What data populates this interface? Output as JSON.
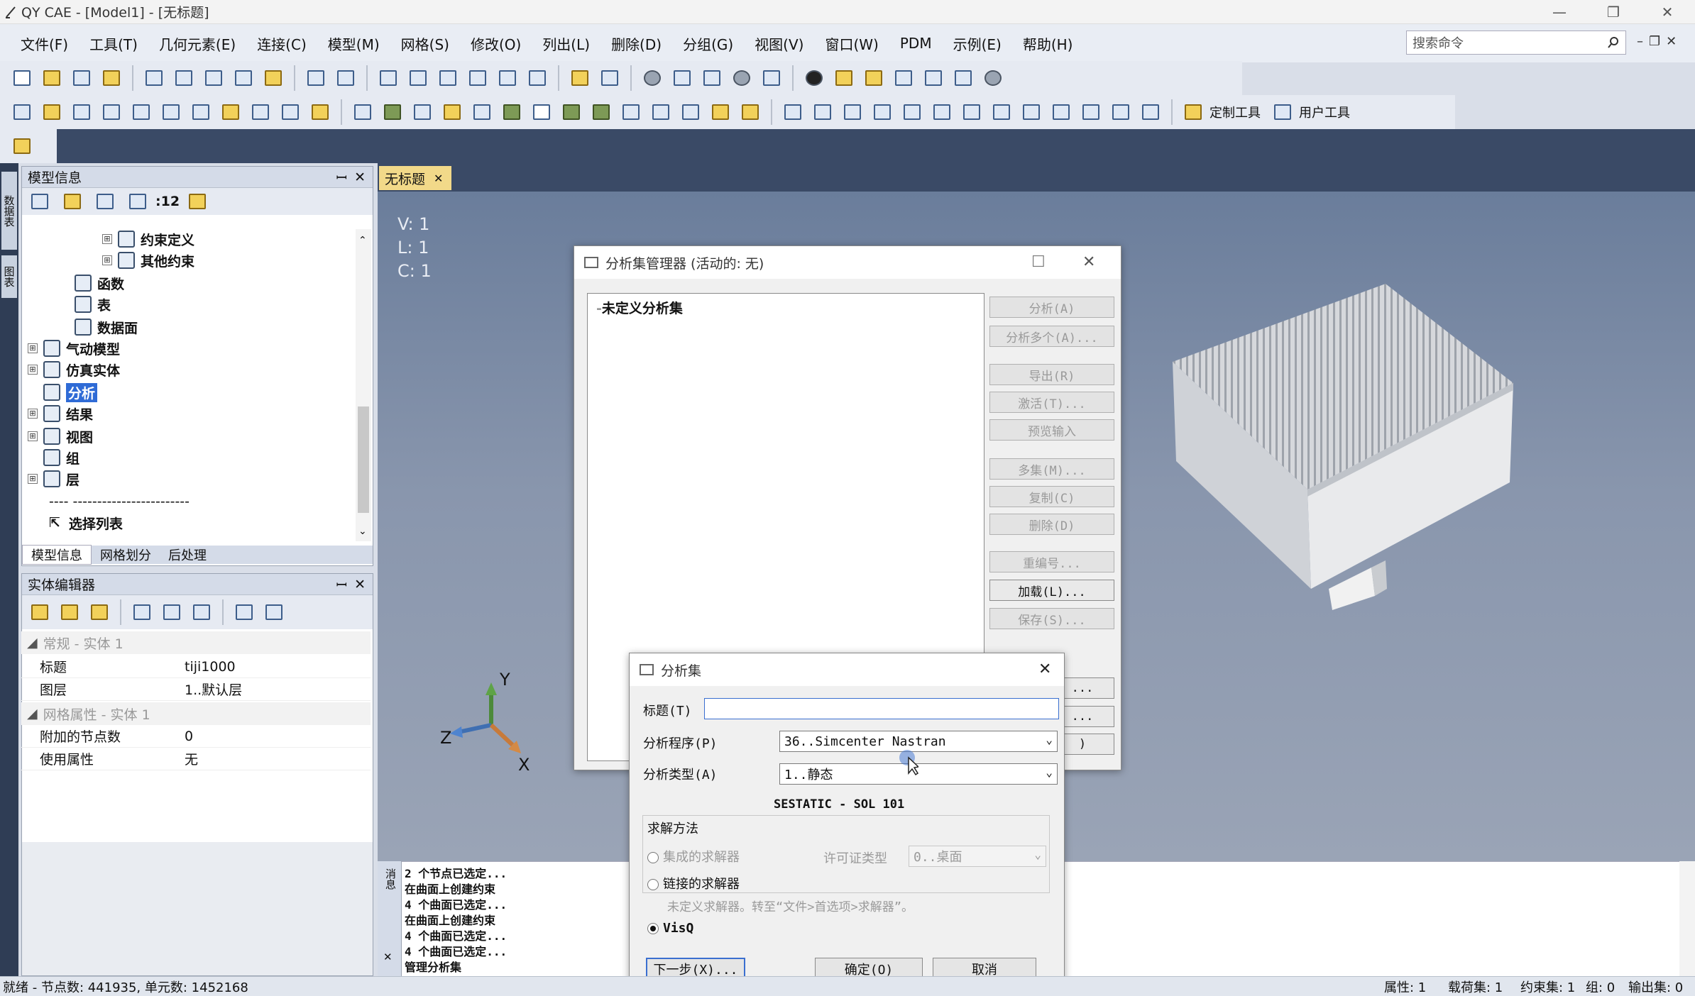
{
  "window": {
    "title": "QY CAE - [Model1] - [无标题]",
    "minimize": "—",
    "restore": "❐",
    "close": "✕"
  },
  "menu": [
    "文件(F)",
    "工具(T)",
    "几何元素(E)",
    "连接(C)",
    "模型(M)",
    "网格(S)",
    "修改(O)",
    "列出(L)",
    "删除(D)",
    "分组(G)",
    "视图(V)",
    "窗口(W)",
    "PDM",
    "示例(E)",
    "帮助(H)"
  ],
  "search": {
    "placeholder": "搜索命令"
  },
  "toolbar": {
    "custom_tools": "定制工具",
    "user_tools": "用户工具"
  },
  "left_tabs": [
    "数据表",
    "图表"
  ],
  "model_panel": {
    "title": "模型信息",
    "pin": "ꟷ",
    "close": "✕",
    "filter_label": ":12",
    "tree": [
      {
        "label": "约束定义",
        "exp": "⊞"
      },
      {
        "label": "其他约束",
        "exp": "⊞"
      },
      {
        "label": "函数",
        "exp": ""
      },
      {
        "label": "表",
        "exp": ""
      },
      {
        "label": "数据面",
        "exp": ""
      },
      {
        "label": "气动模型",
        "exp": "⊞"
      },
      {
        "label": "仿真实体",
        "exp": "⊞"
      },
      {
        "label": "分析",
        "exp": ""
      },
      {
        "label": "结果",
        "exp": "⊞"
      },
      {
        "label": "视图",
        "exp": "⊞"
      },
      {
        "label": "组",
        "exp": ""
      },
      {
        "label": "层",
        "exp": "⊞"
      },
      {
        "label": "---- ------------------------",
        "exp": ""
      },
      {
        "label": "选择列表",
        "exp": ""
      }
    ],
    "tabs": [
      "模型信息",
      "网格划分",
      "后处理"
    ]
  },
  "entity_panel": {
    "title": "实体编辑器",
    "cat1": "常规 - 实体 1",
    "rows1": [
      {
        "k": "标题",
        "v": "tiji1000"
      },
      {
        "k": "图层",
        "v": "1..默认层"
      }
    ],
    "cat2": "网格属性 - 实体 1",
    "rows2": [
      {
        "k": "附加的节点数",
        "v": "0"
      },
      {
        "k": "使用属性",
        "v": "无"
      }
    ]
  },
  "doc_tab": {
    "label": "无标题",
    "close": "✕"
  },
  "view_info": {
    "v": "V: 1",
    "l": "L: 1",
    "c": "C: 1"
  },
  "triad": {
    "x": "X",
    "y": "Y",
    "z": "Z"
  },
  "mgr_dialog": {
    "title": "分析集管理器  (活动的: 无)",
    "max": "☐",
    "close": "✕",
    "list_item": "未定义分析集",
    "buttons": [
      {
        "label": "分析(A)",
        "on": false
      },
      {
        "label": "分析多个(A)...",
        "on": false
      },
      {
        "label": "导出(R)",
        "on": false
      },
      {
        "label": "激活(T)...",
        "on": false
      },
      {
        "label": "预览输入",
        "on": false
      },
      {
        "label": "多集(M)...",
        "on": false
      },
      {
        "label": "复制(C)",
        "on": false
      },
      {
        "label": "删除(D)",
        "on": false
      },
      {
        "label": "重编号...",
        "on": false
      },
      {
        "label": "加载(L)...",
        "on": true
      },
      {
        "label": "保存(S)...",
        "on": false
      }
    ],
    "partial_buttons": [
      "...",
      "...",
      ")"
    ]
  },
  "set_dialog": {
    "title": "分析集",
    "close": "✕",
    "title_label": "标题(T)",
    "title_value": "",
    "program_label": "分析程序(P)",
    "program_value": "36..Simcenter Nastran",
    "type_label": "分析类型(A)",
    "type_value": "1..静态",
    "sol_text": "SESTATIC - SOL 101",
    "solve_group": "求解方法",
    "integrated": "集成的求解器",
    "license_label": "许可证类型",
    "license_value": "0..桌面",
    "linked": "链接的求解器",
    "hint": "未定义求解器。转至“文件>首选项>求解器”。",
    "visq": "VisQ",
    "next": "下一步(X)...",
    "ok": "确定(O)",
    "cancel": "取消"
  },
  "log": {
    "side": "消息",
    "lines": [
      "2 个节点已选定...",
      "在曲面上创建约束",
      "4 个曲面已选定...",
      "在曲面上创建约束",
      "4 个曲面已选定...",
      "4 个曲面已选定...",
      "管理分析集"
    ]
  },
  "status": {
    "left": "就绪 - 节点数: 441935, 单元数: 1452168",
    "items": [
      "属性: 1",
      "载荷集: 1",
      "约束集: 1",
      "组: 0",
      "输出集: 0"
    ]
  }
}
